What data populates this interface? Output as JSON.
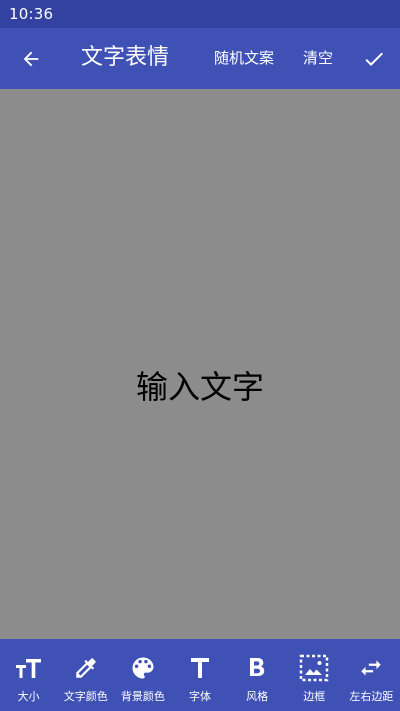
{
  "status_bar": {
    "time": "10:36"
  },
  "app_bar": {
    "title": "文字表情",
    "random_text_label": "随机文案",
    "clear_label": "清空"
  },
  "canvas": {
    "placeholder_text": "输入文字"
  },
  "toolbar": {
    "items": [
      {
        "label": "大小",
        "icon": "text-size-icon"
      },
      {
        "label": "文字颜色",
        "icon": "eyedropper-icon"
      },
      {
        "label": "背景颜色",
        "icon": "palette-icon"
      },
      {
        "label": "字体",
        "icon": "font-t-icon"
      },
      {
        "label": "风格",
        "icon": "bold-b-icon"
      },
      {
        "label": "边框",
        "icon": "frame-icon"
      },
      {
        "label": "左右边距",
        "icon": "swap-horizontal-icon"
      }
    ]
  },
  "colors": {
    "primary": "#3f51b5",
    "status_bar": "#3342a0",
    "canvas_background": "#8c8c8c",
    "on_primary": "#ffffff"
  }
}
